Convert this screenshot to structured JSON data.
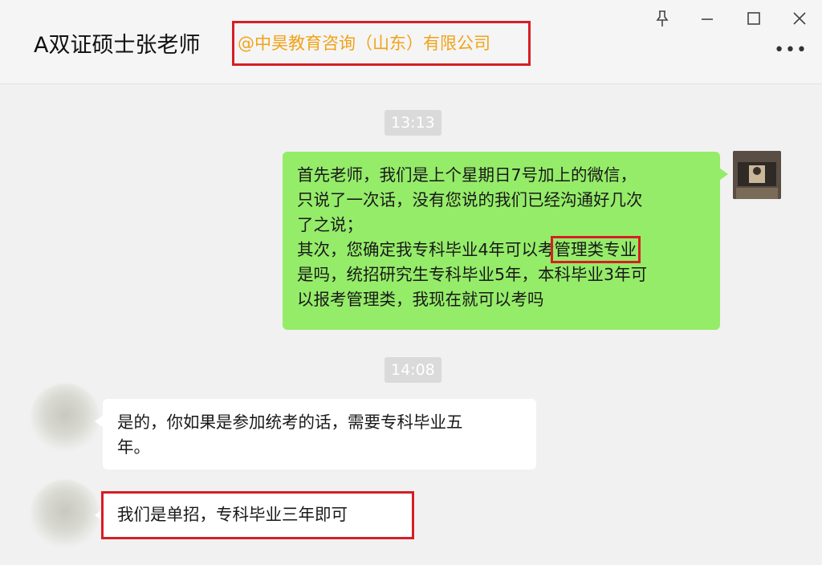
{
  "header": {
    "title": "A双证硕士张老师",
    "company": "@中昊教育咨询（山东）有限公司",
    "more_label": "•••"
  },
  "window_controls": {
    "pin_icon": "pin-icon",
    "minimize_icon": "minimize-icon",
    "maximize_icon": "maximize-icon",
    "close_icon": "close-icon"
  },
  "messages": {
    "time1": "13:13",
    "me": {
      "line1": "首先老师，我们是上个星期日7号加上的微信，",
      "line2": "只说了一次话，没有您说的我们已经沟通好几次",
      "line3": "了之说；",
      "line4_a": "其次，您确定我专科毕业4年可以考",
      "line4_hl": "管理类专业",
      "line5": "是吗，统招研究生专科毕业5年，本科毕业3年可",
      "line6": "以报考管理类，我现在就可以考吗"
    },
    "time2": "14:08",
    "reply1": {
      "line1": "是的，你如果是参加统考的话，需要专科毕业五",
      "line2": "年。"
    },
    "reply2": "我们是单招，专科毕业三年即可"
  },
  "colors": {
    "accent_red": "#d61e25",
    "company_text": "#f0a319",
    "my_bubble": "#95ec69",
    "other_bubble": "#ffffff"
  }
}
